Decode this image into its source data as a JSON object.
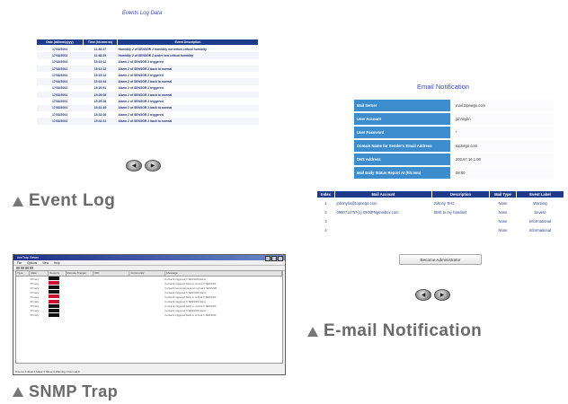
{
  "event_log": {
    "title": "Events Log Data",
    "columns": [
      "Date (dd/mm/yyyy)",
      "Time (hh:mm:ss)",
      "Event Description"
    ],
    "rows": [
      [
        "17/02/2004",
        "11:46:47",
        "Humidity 2 of SENSOR 2 humidity not below critical humidity"
      ],
      [
        "17/02/2004",
        "11:48:29",
        "Humidity 2 of SENSOR 2 under low critical humidity"
      ],
      [
        "17/02/2004",
        "15:10:12",
        "Alarm 2 of SENSOR 2 triggered"
      ],
      [
        "17/02/2004",
        "15:13:13",
        "Alarm 2 of SENSOR 2 back to normal"
      ],
      [
        "17/02/2004",
        "15:15:12",
        "Alarm 2 of SENSOR 2 triggered"
      ],
      [
        "17/02/2004",
        "15:15:44",
        "Alarm 2 of SENSOR 2 back to normal"
      ],
      [
        "17/02/2004",
        "15:20:51",
        "Alarm 2 of SENSOR 2 triggered"
      ],
      [
        "17/02/2004",
        "15:26:08",
        "Alarm 2 of SENSOR 2 back to normal"
      ],
      [
        "17/02/2004",
        "15:29:26",
        "Alarm 2 of SENSOR 2 triggered"
      ],
      [
        "17/02/2004",
        "15:31:35",
        "Alarm 2 of SENSOR 2 back to normal"
      ],
      [
        "17/02/2004",
        "15:32:26",
        "Alarm 2 of SENSOR 2 triggered"
      ],
      [
        "17/02/2004",
        "15:32:31",
        "Alarm 2 of SENSOR 2 back to normal"
      ]
    ],
    "prev_label": "◀",
    "next_label": "▶",
    "caption": "Event Log"
  },
  "email": {
    "title": "Email Notification",
    "fields": [
      {
        "label": "Mail Server",
        "value": "mail.topnego.com"
      },
      {
        "label": "User Account",
        "value": "johnnylin"
      },
      {
        "label": "User Password",
        "value": "*"
      },
      {
        "label": "Domain Name for Sender's Email Address",
        "value": "topnego.com"
      },
      {
        "label": "DNS Address",
        "value": "203.67.16.1.00"
      },
      {
        "label": "Mail Daily Status Report At (hh:mm)",
        "value": "08:00"
      }
    ],
    "columns": [
      "Index",
      "Mail Account",
      "Description",
      "Mail Type",
      "Event Label"
    ],
    "rows": [
      [
        "1",
        "johnnylin@topnego.com",
        "Johnny Test",
        "None",
        "Warning"
      ],
      [
        "2",
        "0960711757(1) OKNPNgmaibox.com",
        "SMS to my handset",
        "None",
        "Severe"
      ],
      [
        "3",
        "",
        "",
        "None",
        "Informational"
      ],
      [
        "4",
        "",
        "",
        "None",
        "Informational"
      ]
    ],
    "admin_button": "Become Administrator",
    "prev_label": "◀",
    "next_label": "▶",
    "caption": "E-mail Notification"
  },
  "snmp": {
    "window_title": "AnnTrap Viewer",
    "menus": [
      "File",
      "Options",
      "View",
      "Help"
    ],
    "grid_columns": [
      "Type",
      "Date",
      "Severity",
      "Remote Trapper",
      "OID",
      "Community",
      "Message"
    ],
    "rows": [
      {
        "type": "",
        "date": "Primary",
        "severity_color": "#111111",
        "msg": "Contact1 triggered fr SENSOR Alarm"
      },
      {
        "type": "",
        "date": "Primary",
        "severity_color": "#cc1133",
        "msg": "Contact1 triggered back to normal fr SENSOR"
      },
      {
        "type": "",
        "date": "Primary",
        "severity_color": "#111111",
        "msg": "Contact1 temperature level normal fr SENSOR"
      },
      {
        "type": "",
        "date": "Primary",
        "severity_color": "#111111",
        "msg": "Contact1 triggered fr SENSOR Alarm"
      },
      {
        "type": "",
        "date": "Primary",
        "severity_color": "#cc1133",
        "msg": "Contact1 triggered back to normal fr SENSOR"
      },
      {
        "type": "",
        "date": "Primary",
        "severity_color": "#cc1133",
        "msg": "Contact1 triggered fr SENSOR Alarm"
      },
      {
        "type": "",
        "date": "Primary",
        "severity_color": "#111111",
        "msg": "Contact1 triggered back to normal fr SENSOR"
      },
      {
        "type": "",
        "date": "Primary",
        "severity_color": "#111111",
        "msg": "Contact1 triggered fr SENSOR Alarm"
      },
      {
        "type": "",
        "date": "Primary",
        "severity_color": "#111111",
        "msg": "Contact1 triggered back to normal fr SENSOR"
      }
    ],
    "status_text": "0 Items    Critical 0  Major 0  Minor 0  Warning 0  Normal 0",
    "caption": "SNMP Trap"
  }
}
